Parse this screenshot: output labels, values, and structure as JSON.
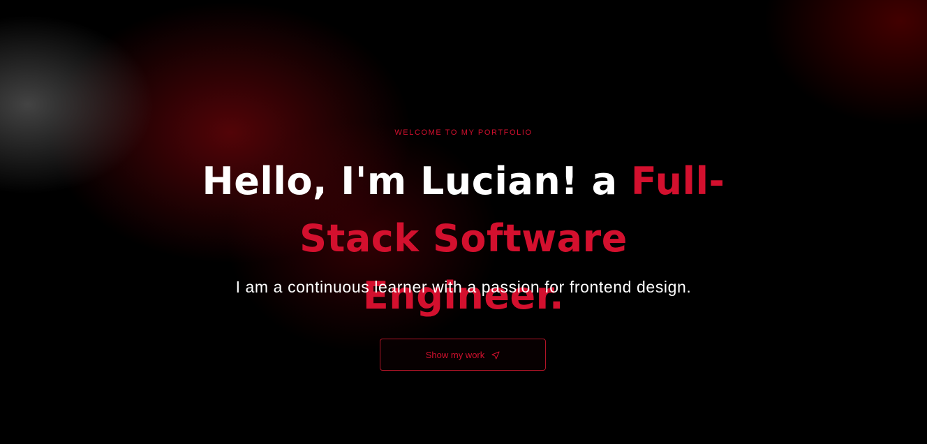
{
  "hero": {
    "eyebrow": "WELCOME TO MY PORTFOLIO",
    "headline_intro": "Hello, I'm Lucian! a ",
    "headline_accent": "Full-Stack Software Engineer.",
    "subtitle": "I am a continuous learner with a passion for frontend design.",
    "cta_label": "Show my work",
    "cta_icon": "send-icon"
  },
  "colors": {
    "background": "#000000",
    "accent": "#d3102e",
    "text": "#ffffff"
  }
}
